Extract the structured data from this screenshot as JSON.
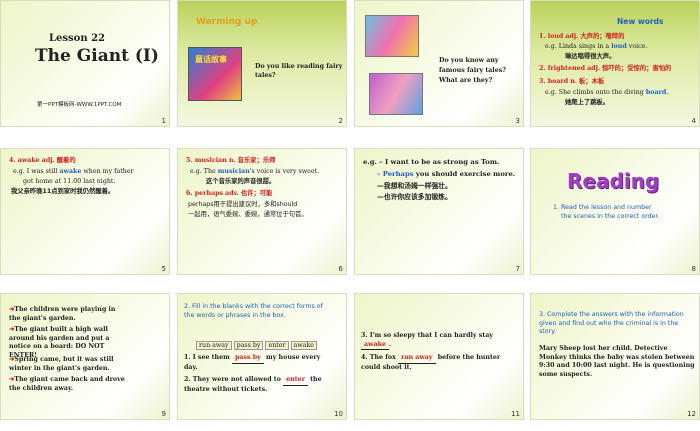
{
  "slides": [
    {
      "num": "1",
      "lesson": "Lesson 22",
      "title": "The Giant (I)",
      "footer": "第一PPT模板网-WWW.1PPT.COM"
    },
    {
      "num": "2",
      "heading": "Warming up",
      "book_title": "童话故事",
      "question": "Do you like reading fairy tales?"
    },
    {
      "num": "3",
      "question_l1": "Do you know any",
      "question_l2": "famous fairy tales?",
      "question_l3": "What are they?"
    },
    {
      "num": "4",
      "heading": "New words",
      "w1": "1. loud",
      "w1_pos": "adj.",
      "w1_cn": "大声的；喧哗的",
      "ex1_pre": "e.g. Linda  sings in a ",
      "ex1_kw": "loud",
      "ex1_post": " voice.",
      "ex1_cn": "琳达唱得很大声。",
      "w2": "2. frightened",
      "w2_pos": "adj.",
      "w2_cn": "惊吓的；受惊的；害怕的",
      "w3": "3. board",
      "w3_pos": "n.",
      "w3_cn": "板；木板",
      "ex3_pre": "e.g. She climbs onto the diving ",
      "ex3_kw": "board",
      "ex3_post": ".",
      "ex3_cn": "她爬上了跳板。"
    },
    {
      "num": "5",
      "w4": "4. awake",
      "w4_pos": "adj.",
      "w4_cn": "醒着的",
      "ex_l1_pre": "e.g. I was still ",
      "ex_l1_kw": "awake",
      "ex_l1_post": "  when  my father",
      "ex_l2": "got home  at 11.00 last night.",
      "ex_cn": "我父亲昨晚11点到家时我仍然醒着。"
    },
    {
      "num": "6",
      "w5": "5. musician",
      "w5_pos": "n.",
      "w5_cn": "音乐家；乐师",
      "ex_pre": "e.g. The ",
      "ex_kw": "musician",
      "ex_post": "'s voice is very  sweet.",
      "ex_cn": "这个音乐家的声音很甜。",
      "w6": "6. perhaps",
      "w6_pos": "adv.",
      "w6_cn": "也许；可能",
      "note_l1": "perhaps用于提出建议时，多和should",
      "note_l2": "一起用，语气委婉、委婉，通常位于句首。"
    },
    {
      "num": "7",
      "l1": "e.g. – I want to be as strong as Tom.",
      "l2_kw": "– Perhaps",
      "l2_post": " you should exercise more.",
      "l3": "—我想和汤姆一样强壮。",
      "l4": "—也许你应该多加锻炼。"
    },
    {
      "num": "8",
      "heading": "Reading",
      "task_l1": "1.  Read the lesson  and number",
      "task_l2": "the scenes  in the correct order."
    },
    {
      "num": "9",
      "s1": "The children were playing in the giant's garden.",
      "s2": "The giant built a high wall around his garden and put a notice on a board:  DO NOT ENTER!",
      "s3": "Spring came,  but it was still winter in the giant's garden.",
      "s4": "The giant came back and drove  the children away."
    },
    {
      "num": "10",
      "task": "2.  Fill in the blanks with the correct forms of the words or phrases  in the box.",
      "box_words": [
        "run away",
        "pass by",
        "enter",
        "awake"
      ],
      "q1_pre": "1. I see them ",
      "q1_ans": "pass by",
      "q1_post": " my house every day.",
      "q2_pre": "2. They were not allowed to ",
      "q2_ans": "enter",
      "q2_post": " the theatre without  tickets."
    },
    {
      "num": "11",
      "q3_pre": "3. I'm  so sleepy that I can hardly  stay",
      "q3_ans": "awake",
      "q3_post": ".",
      "q4_pre": "4. The fox ",
      "q4_ans": "ran away",
      "q4_post": " before the hunter could  shoot it."
    },
    {
      "num": "12",
      "task": "3.  Complete the answers with the information given and find out who the criminal is in the story.",
      "story": "Mary  Sheep lost her child.  Detective  Monkey  thinks the baby  was stolen between  9:30 and 10:00 last night.  He is questioning  some  suspects."
    }
  ]
}
